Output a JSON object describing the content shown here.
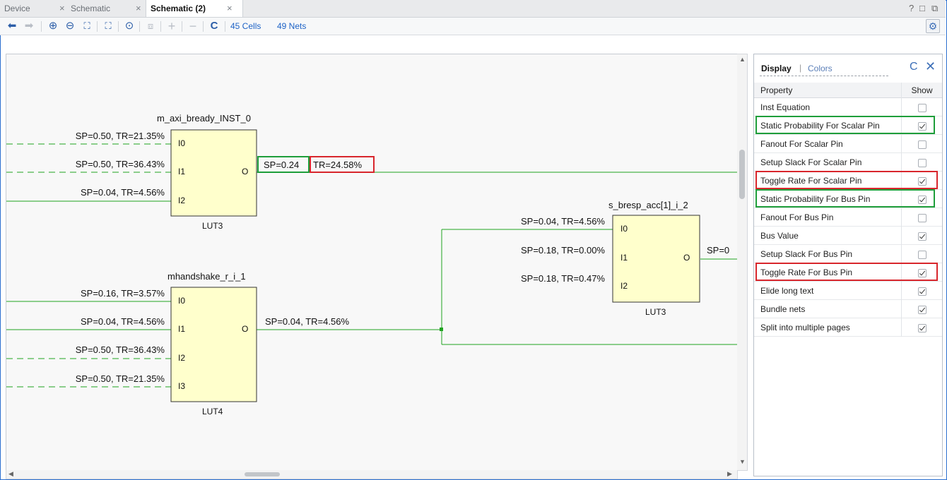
{
  "tabs": [
    {
      "label": "Device",
      "active": false
    },
    {
      "label": "Schematic",
      "active": false
    },
    {
      "label": "Schematic (2)",
      "active": true
    }
  ],
  "window_controls": {
    "help": "?",
    "restore": "□",
    "float": "⧉"
  },
  "toolbar": {
    "buttons": [
      {
        "name": "back",
        "glyph": "⬅",
        "enabled": true
      },
      {
        "name": "forward",
        "glyph": "➡",
        "enabled": false
      },
      {
        "name": "zoom-in",
        "glyph": "⊕",
        "enabled": true
      },
      {
        "name": "zoom-out",
        "glyph": "⊖",
        "enabled": true
      },
      {
        "name": "zoom-fit",
        "glyph": "⛶",
        "enabled": true
      },
      {
        "name": "zoom-selection",
        "glyph": "⛶",
        "enabled": true
      },
      {
        "name": "autofit-selection",
        "glyph": "⊙",
        "enabled": true
      },
      {
        "name": "regenerate",
        "glyph": "⧈",
        "enabled": false
      },
      {
        "name": "expand",
        "glyph": "+",
        "enabled": false
      },
      {
        "name": "collapse",
        "glyph": "−",
        "enabled": false
      },
      {
        "name": "refresh",
        "glyph": "C",
        "enabled": true
      }
    ],
    "cells": "45 Cells",
    "nets": "49 Nets"
  },
  "schematic": {
    "cells": [
      {
        "id": "c1",
        "title": "m_axi_bready_INST_0",
        "type": "LUT3",
        "pins": [
          "I0",
          "I1",
          "I2"
        ],
        "out": "O"
      },
      {
        "id": "c2",
        "title": "mhandshake_r_i_1",
        "type": "LUT4",
        "pins": [
          "I0",
          "I1",
          "I2",
          "I3"
        ],
        "out": "O"
      },
      {
        "id": "c3",
        "title": "s_bresp_acc[1]_i_2",
        "type": "LUT3",
        "pins": [
          "I0",
          "I1",
          "I2"
        ],
        "out": "O"
      }
    ],
    "labels": {
      "c1_i0": "SP=0.50, TR=21.35%",
      "c1_i1": "SP=0.50, TR=36.43%",
      "c1_i2": "SP=0.04, TR=4.56%",
      "c1_out_sp": "SP=0.24",
      "c1_out_tr": "TR=24.58%",
      "c2_i0": "SP=0.16, TR=3.57%",
      "c2_i1": "SP=0.04, TR=4.56%",
      "c2_i2": "SP=0.50, TR=36.43%",
      "c2_i3": "SP=0.50, TR=21.35%",
      "c2_out": "SP=0.04, TR=4.56%",
      "c3_i0": "SP=0.04, TR=4.56%",
      "c3_i1": "SP=0.18, TR=0.00%",
      "c3_i2": "SP=0.18, TR=0.47%",
      "c3_out": "SP=0"
    }
  },
  "panel": {
    "tab_display": "Display",
    "tab_sep": "|",
    "tab_colors": "Colors",
    "refresh_glyph": "C",
    "close_glyph": "✕",
    "header": {
      "property": "Property",
      "show": "Show"
    },
    "rows": [
      {
        "label": "Inst Equation",
        "checked": false,
        "highlight": ""
      },
      {
        "label": "Static Probability For Scalar Pin",
        "checked": true,
        "highlight": "green"
      },
      {
        "label": "Fanout For Scalar Pin",
        "checked": false,
        "highlight": ""
      },
      {
        "label": "Setup Slack For Scalar Pin",
        "checked": false,
        "highlight": ""
      },
      {
        "label": "Toggle Rate For Scalar Pin",
        "checked": true,
        "highlight": "red"
      },
      {
        "label": "Static Probability For Bus Pin",
        "checked": true,
        "highlight": "green"
      },
      {
        "label": "Fanout For Bus Pin",
        "checked": false,
        "highlight": ""
      },
      {
        "label": "Bus Value",
        "checked": true,
        "highlight": ""
      },
      {
        "label": "Setup Slack For Bus Pin",
        "checked": false,
        "highlight": ""
      },
      {
        "label": "Toggle Rate For Bus Pin",
        "checked": true,
        "highlight": "red"
      },
      {
        "label": "Elide long text",
        "checked": true,
        "highlight": ""
      },
      {
        "label": "Bundle nets",
        "checked": true,
        "highlight": ""
      },
      {
        "label": "Split into multiple pages",
        "checked": true,
        "highlight": ""
      }
    ]
  },
  "colors": {
    "net": "#1fa31f",
    "cell_fill": "#ffffcc",
    "highlight_green": "#1e9e3a",
    "highlight_red": "#d8262c",
    "accent": "#1e63c6"
  }
}
